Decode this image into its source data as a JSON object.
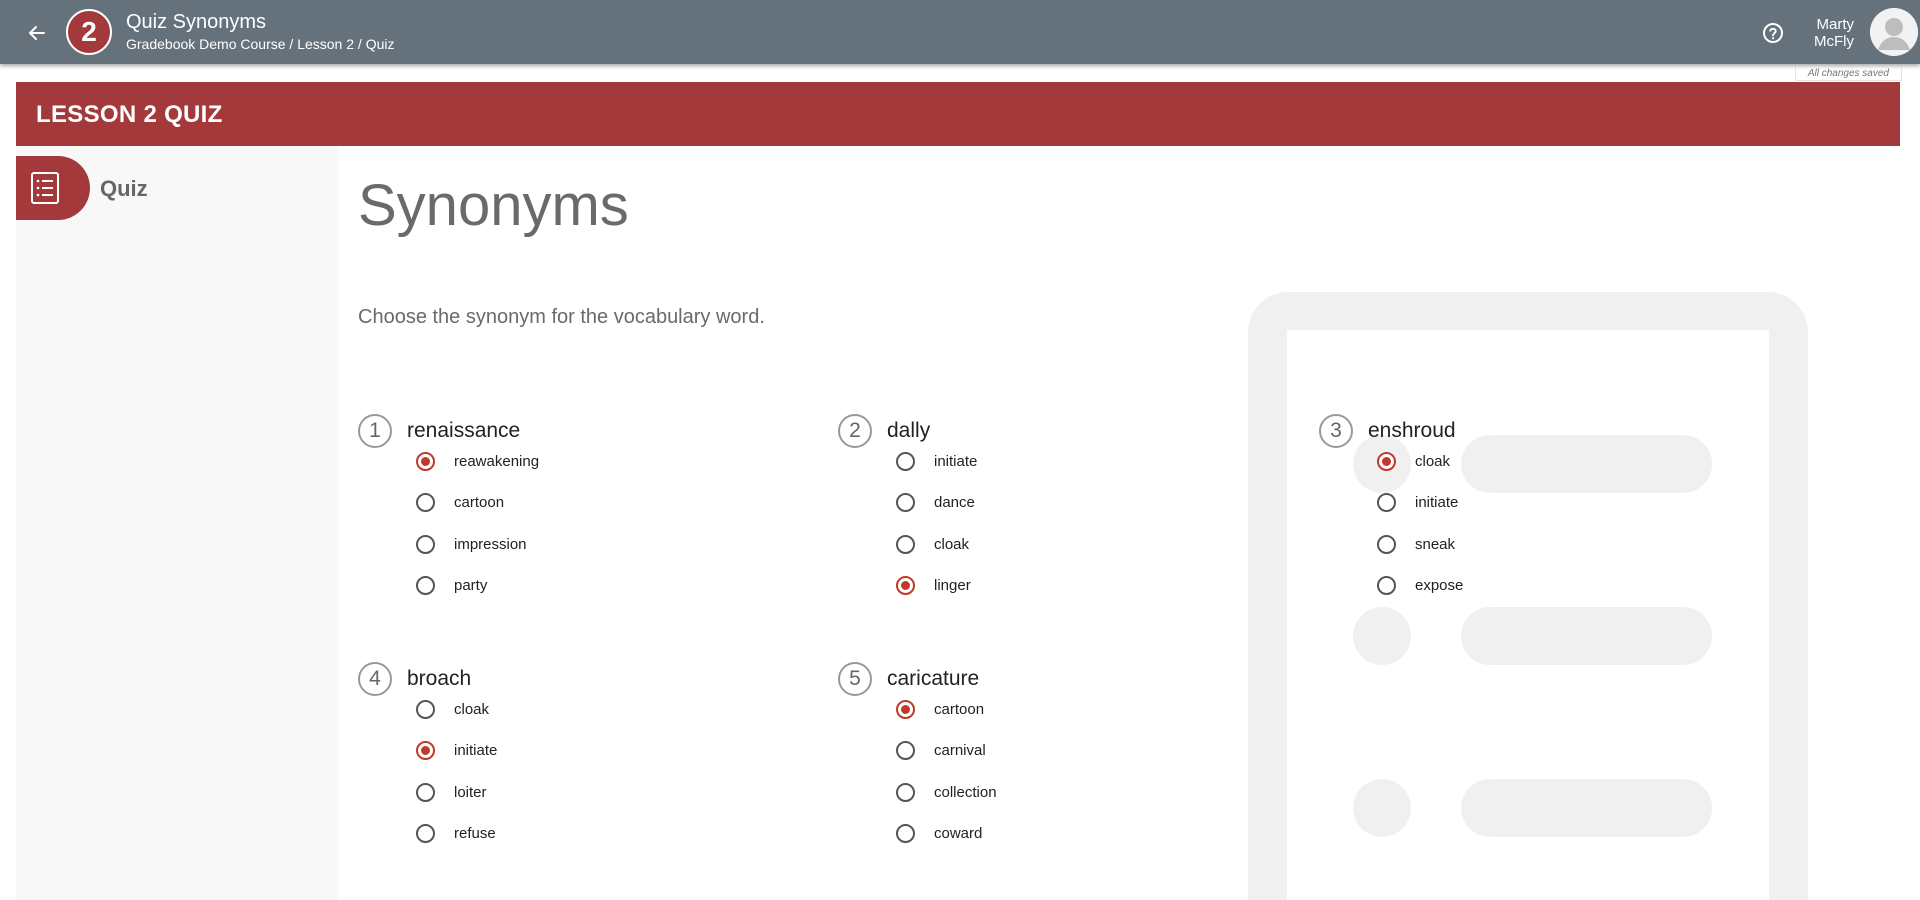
{
  "header": {
    "logo_text": "2",
    "title": "Quiz Synonyms",
    "breadcrumb": [
      "Gradebook Demo Course",
      "Lesson 2",
      "Quiz"
    ],
    "breadcrumb_separator": " / ",
    "user_first": "Marty",
    "user_last": "McFly",
    "save_status": "All changes saved"
  },
  "lesson": {
    "title": "LESSON 2 QUIZ"
  },
  "sidebar": {
    "items": [
      {
        "label": "Quiz",
        "icon": "list-icon",
        "active": true
      }
    ]
  },
  "main": {
    "title": "Synonyms",
    "instructions": "Choose the synonym for the vocabulary word."
  },
  "questions": [
    {
      "number": "1",
      "word": "renaissance",
      "options": [
        "reawakening",
        "cartoon",
        "impression",
        "party"
      ],
      "selected": 0
    },
    {
      "number": "2",
      "word": "dally",
      "options": [
        "initiate",
        "dance",
        "cloak",
        "linger"
      ],
      "selected": 3
    },
    {
      "number": "3",
      "word": "enshroud",
      "options": [
        "cloak",
        "initiate",
        "sneak",
        "expose"
      ],
      "selected": 0
    },
    {
      "number": "4",
      "word": "broach",
      "options": [
        "cloak",
        "initiate",
        "loiter",
        "refuse"
      ],
      "selected": 1
    },
    {
      "number": "5",
      "word": "caricature",
      "options": [
        "cartoon",
        "carnival",
        "collection",
        "coward"
      ],
      "selected": 0
    }
  ],
  "colors": {
    "topbar": "#65727c",
    "accent": "#a3393a",
    "radio_checked": "#c0392b",
    "placeholder": "#f0f0f0"
  }
}
